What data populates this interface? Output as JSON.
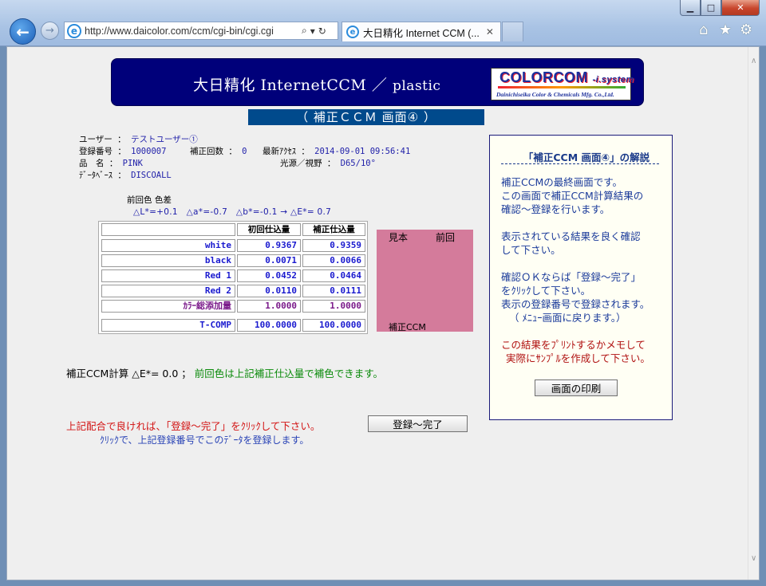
{
  "browser": {
    "address": "http://www.daicolor.com/ccm/cgi-bin/cgi.cgi",
    "tab_title": "大日精化 Internet CCM (...",
    "window_buttons": [
      "minimize",
      "maximize",
      "close"
    ]
  },
  "banner": {
    "title": "大日精化 InternetCCM ／",
    "subtitle": "plastic",
    "logo_main": "COLORCOM",
    "logo_tag": "-i.system",
    "logo_company": "Dainichiseika Color & Chemicals Mfg. Co.,Ltd."
  },
  "screen_title": "（ 補正ＣＣＭ 画面④ ）",
  "info": {
    "user_label": "ユーザー",
    "user_value": "テストユーザー①",
    "reg_label": "登録番号",
    "reg_value": "1000007",
    "corr_label": "補正回数",
    "corr_value": "0",
    "access_label": "最新ｱｸｾｽ",
    "access_value": "2014-09-01 09:56:41",
    "item_label": "品　名",
    "item_value": "PINK",
    "light_label": "光源／視野",
    "light_value": "D65/10°",
    "db_label": "ﾃﾞｰﾀﾍﾞｰｽ",
    "db_value": "DISCOALL"
  },
  "delta": {
    "label": "前回色 色差",
    "values": "△L*=+0.1　△a*=-0.7　△b*=-0.1 → △E*= 0.7"
  },
  "recipe": {
    "headers": [
      "",
      "初回仕込量",
      "補正仕込量"
    ],
    "rows": [
      {
        "name": "white",
        "v1": "0.9367",
        "v2": "0.9359"
      },
      {
        "name": "black",
        "v1": "0.0071",
        "v2": "0.0066"
      },
      {
        "name": "Red  1",
        "v1": "0.0452",
        "v2": "0.0464"
      },
      {
        "name": "Red  2",
        "v1": "0.0110",
        "v2": "0.0111"
      },
      {
        "name": "ｶﾗｰ総添加量",
        "v1": "1.0000",
        "v2": "1.0000"
      }
    ],
    "total": {
      "name": "T-COMP",
      "v1": "100.0000",
      "v2": "100.0000"
    }
  },
  "swatch": {
    "sample_label": "見本",
    "previous_label": "前回",
    "corrected_label": "補正CCM",
    "color": "#d47b9b"
  },
  "result": {
    "label": "補正CCM計算 △E*= 0.0 ；",
    "message": "前回色は上記補正仕込量で補色できます。"
  },
  "confirm": {
    "message": "上記配合で良ければ、「登録～完了」をｸﾘｯｸして下さい。",
    "sub": "ｸﾘｯｸで、上記登録番号でこのﾃﾞｰﾀを登録します。",
    "button": "登録～完了"
  },
  "explain": {
    "title": "「補正CCM 画面④」の解説",
    "lines": [
      "補正CCMの最終画面です。",
      "この画面で補正CCM計算結果の",
      "確認～登録を行います。",
      "表示されている結果を良く確認",
      "して下さい。",
      "確認ＯＫならば「登録～完了」",
      "をｸﾘｯｸして下さい。",
      "表示の登録番号で登録されます。",
      "（ ﾒﾆｭｰ画面に戻ります。）"
    ],
    "red_lines": [
      "この結果をﾌﾟﾘﾝﾄするかメモして",
      "実際にｻﾝﾌﾟﾙを作成して下さい。"
    ],
    "print_button": "画面の印刷"
  }
}
